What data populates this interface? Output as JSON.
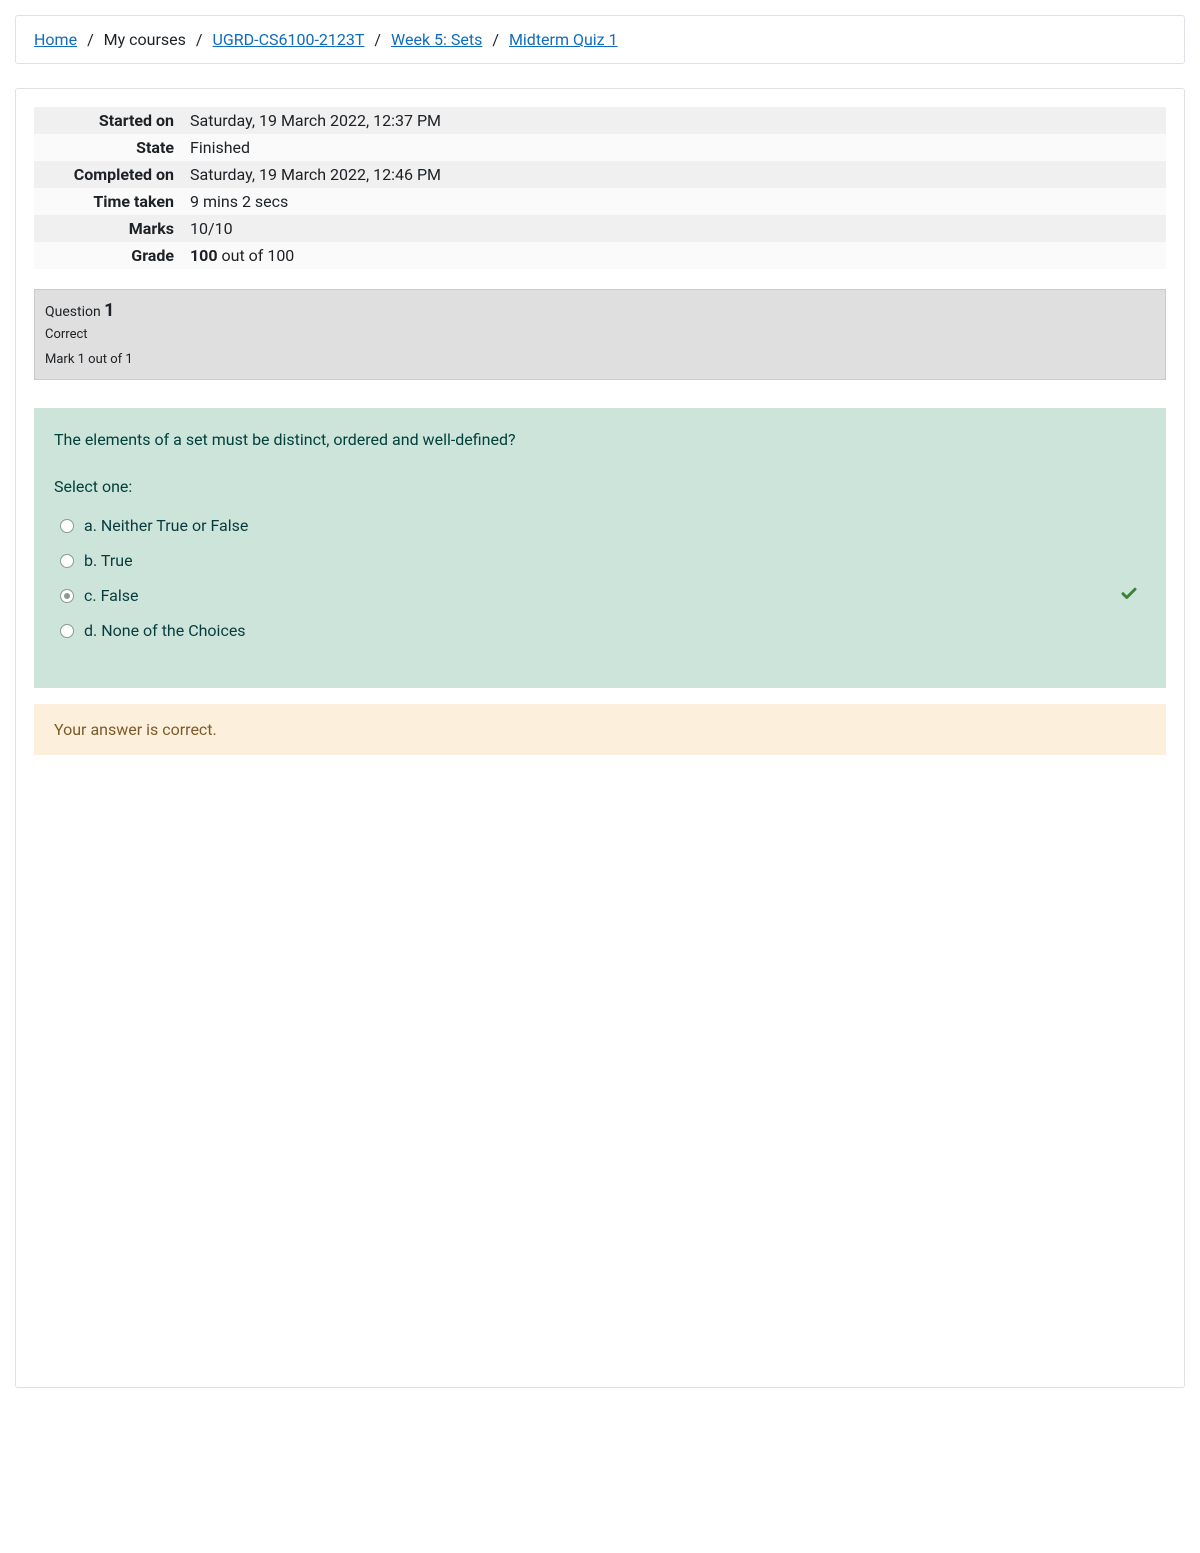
{
  "breadcrumb": [
    {
      "label": "Home",
      "link": true
    },
    {
      "label": "My courses",
      "link": false
    },
    {
      "label": "UGRD-CS6100-2123T",
      "link": true
    },
    {
      "label": "Week 5: Sets",
      "link": true
    },
    {
      "label": "Midterm Quiz 1",
      "link": true
    }
  ],
  "summary": {
    "started_on": {
      "label": "Started on",
      "value": "Saturday, 19 March 2022, 12:37 PM"
    },
    "state": {
      "label": "State",
      "value": "Finished"
    },
    "completed_on": {
      "label": "Completed on",
      "value": "Saturday, 19 March 2022, 12:46 PM"
    },
    "time_taken": {
      "label": "Time taken",
      "value": "9 mins 2 secs"
    },
    "marks": {
      "label": "Marks",
      "value": "10/10"
    },
    "grade": {
      "label": "Grade",
      "value_bold": "100",
      "value_rest": " out of 100"
    }
  },
  "question": {
    "heading_prefix": "Question ",
    "number": "1",
    "status": "Correct",
    "mark_text": "Mark 1 out of 1",
    "text": "The elements of a set must be distinct, ordered and well-defined?",
    "prompt": "Select one:",
    "options": [
      {
        "letter": "a.",
        "text": "Neither True or False",
        "selected": false,
        "correct": false
      },
      {
        "letter": "b.",
        "text": "True",
        "selected": false,
        "correct": false
      },
      {
        "letter": "c.",
        "text": "False",
        "selected": true,
        "correct": true
      },
      {
        "letter": "d.",
        "text": "None of the Choices",
        "selected": false,
        "correct": false
      }
    ]
  },
  "feedback": "Your answer is correct."
}
